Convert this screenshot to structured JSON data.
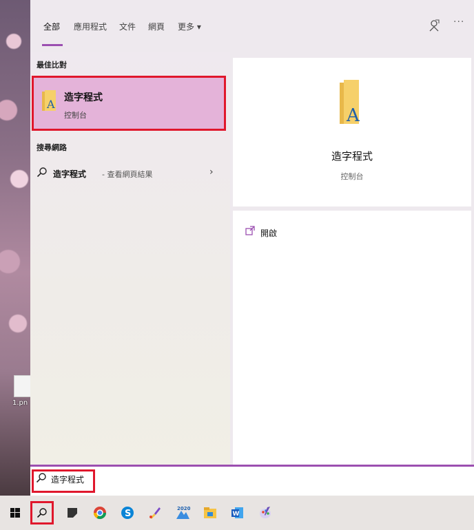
{
  "tabs": [
    {
      "label": "全部"
    },
    {
      "label": "應用程式"
    },
    {
      "label": "文件"
    },
    {
      "label": "網頁"
    },
    {
      "label": "更多 ▾"
    }
  ],
  "header_icons": [
    "feedback-icon",
    "more-options-icon"
  ],
  "best_match": {
    "section_title": "最佳比對",
    "app_name": "造字程式",
    "app_type": "控制台"
  },
  "web_search": {
    "section_title": "搜尋網路",
    "query": "造字程式",
    "suffix": "- 查看網頁結果"
  },
  "preview": {
    "app_name": "造字程式",
    "app_type": "控制台",
    "open_label": "開啟"
  },
  "search": {
    "value": "造字程式"
  },
  "desktop": {
    "file_label": "1.pn"
  },
  "taskbar": {
    "items": [
      "start-button",
      "search-button",
      "task-view",
      "chrome",
      "skype",
      "paint",
      "photos-2020",
      "file-explorer",
      "word",
      "paint-3d"
    ]
  },
  "colors": {
    "accent": "#9b4fb0",
    "highlight_border": "#e0172c",
    "best_match_bg": "#e4b3d9"
  }
}
